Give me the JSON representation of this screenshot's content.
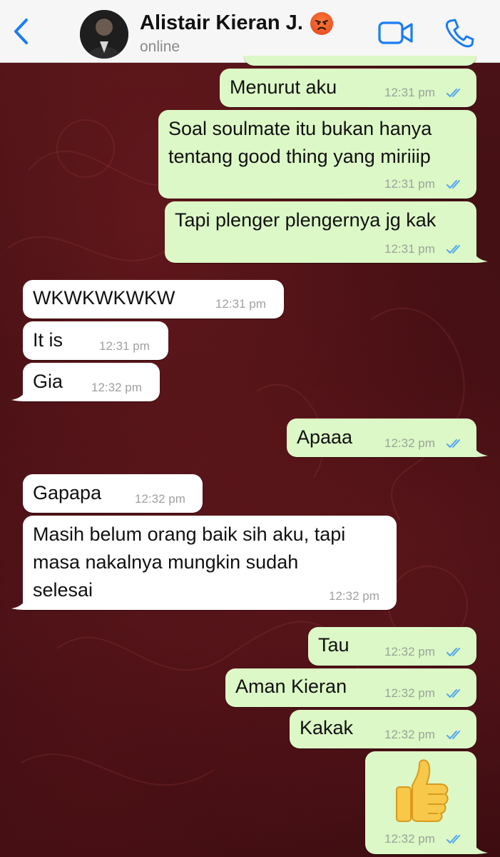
{
  "header": {
    "contact_name": "Alistair Kieran J.",
    "contact_status": "online",
    "name_emoji": "pouting-face-emoji",
    "back_icon": "chevron-left-icon",
    "video_icon": "video-camera-icon",
    "call_icon": "phone-icon"
  },
  "colors": {
    "accent": "#1a7df0",
    "outgoing_bubble": "#dcf8c6",
    "incoming_bubble": "#ffffff",
    "read_ticks": "#4fa6f0",
    "wallpaper": "#3a0c10"
  },
  "messages": [
    {
      "dir": "out",
      "text": "Menurut aku",
      "time": "12:31 pm",
      "status": "read"
    },
    {
      "dir": "out",
      "text": "Soal soulmate itu bukan hanya\ntentang good thing yang miriiip",
      "time": "12:31 pm",
      "status": "read"
    },
    {
      "dir": "out",
      "text": "Tapi plenger plengernya jg kak",
      "time": "12:31 pm",
      "status": "read"
    },
    {
      "dir": "in",
      "text": "WKWKWKWKW",
      "time": "12:31 pm"
    },
    {
      "dir": "in",
      "text": "It is",
      "time": "12:31 pm"
    },
    {
      "dir": "in",
      "text": "Gia",
      "time": "12:32 pm"
    },
    {
      "dir": "out",
      "text": "Apaaa",
      "time": "12:32 pm",
      "status": "read"
    },
    {
      "dir": "in",
      "text": "Gapapa",
      "time": "12:32 pm"
    },
    {
      "dir": "in",
      "text": "Masih belum orang baik sih aku, tapi\nmasa nakalnya mungkin sudah\nselesai",
      "time": "12:32 pm"
    },
    {
      "dir": "out",
      "text": "Tau",
      "time": "12:32 pm",
      "status": "read"
    },
    {
      "dir": "out",
      "text": "Aman Kieran",
      "time": "12:32 pm",
      "status": "read"
    },
    {
      "dir": "out",
      "text": "Kakak",
      "time": "12:32 pm",
      "status": "read"
    },
    {
      "dir": "out",
      "emoji": "thumbs-up-emoji",
      "time": "12:32 pm",
      "status": "read"
    }
  ]
}
